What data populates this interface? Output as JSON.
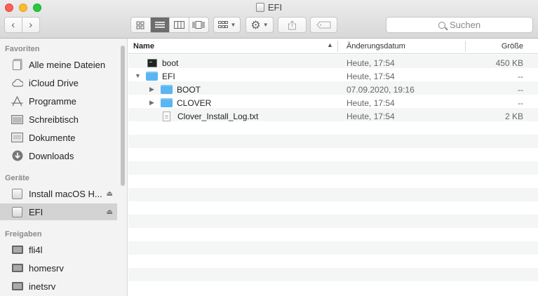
{
  "window": {
    "title": "EFI"
  },
  "toolbar": {
    "back_icon": "chevron-left-icon",
    "forward_icon": "chevron-right-icon",
    "views": [
      "icon-view",
      "list-view",
      "column-view",
      "cover-flow-view"
    ],
    "search_placeholder": "Suchen"
  },
  "sidebar": {
    "favorites_header": "Favoriten",
    "favorites": [
      {
        "label": "Alle meine Dateien",
        "icon": "all-files-icon"
      },
      {
        "label": "iCloud Drive",
        "icon": "cloud-icon"
      },
      {
        "label": "Programme",
        "icon": "applications-icon"
      },
      {
        "label": "Schreibtisch",
        "icon": "desktop-icon"
      },
      {
        "label": "Dokumente",
        "icon": "documents-icon"
      },
      {
        "label": "Downloads",
        "icon": "downloads-icon"
      }
    ],
    "devices_header": "Geräte",
    "devices": [
      {
        "label": "Install macOS H...",
        "icon": "drive-icon",
        "eject": true
      },
      {
        "label": "EFI",
        "icon": "drive-icon",
        "eject": true,
        "selected": true
      }
    ],
    "shared_header": "Freigaben",
    "shared": [
      {
        "label": "fli4l",
        "icon": "monitor-icon"
      },
      {
        "label": "homesrv",
        "icon": "monitor-icon"
      },
      {
        "label": "inetsrv",
        "icon": "monitor-icon"
      }
    ]
  },
  "list": {
    "columns": {
      "name": "Name",
      "date": "Änderungsdatum",
      "size": "Größe"
    },
    "rows": [
      {
        "name": "boot",
        "date": "Heute, 17:54",
        "size": "450 KB",
        "icon": "terminal-file-icon",
        "level": 0
      },
      {
        "name": "EFI",
        "date": "Heute, 17:54",
        "size": "--",
        "icon": "folder-icon",
        "level": 0,
        "expanded": true
      },
      {
        "name": "BOOT",
        "date": "07.09.2020, 19:16",
        "size": "--",
        "icon": "folder-icon",
        "level": 1,
        "expanded": false
      },
      {
        "name": "CLOVER",
        "date": "Heute, 17:54",
        "size": "--",
        "icon": "folder-icon",
        "level": 1,
        "expanded": false
      },
      {
        "name": "Clover_Install_Log.txt",
        "date": "Heute, 17:54",
        "size": "2 KB",
        "icon": "text-file-icon",
        "level": 1
      }
    ]
  },
  "colors": {
    "folder": "#5ab6f1",
    "selection": "#d3d3d3",
    "sidebar_bg": "#f3f3f3"
  }
}
